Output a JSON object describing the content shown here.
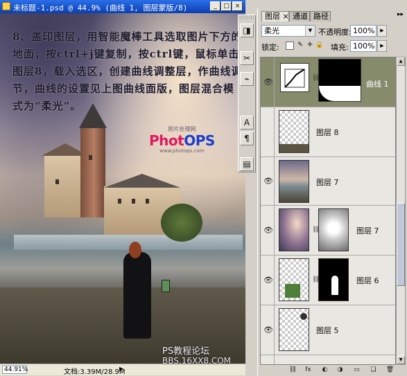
{
  "document": {
    "title": "未标题-1.psd @ 44.9% (曲线 1, 图层蒙版/8)",
    "instruction_text": "8、盖印图层，用智能魔棒工具选取图片下方的地面，按ctrl+j键复制，按ctrl键，鼠标单击图层8，载入选区，创建曲线调整层，作曲线调节，曲线的设置见上图曲线面版，图层混合模式为“柔光”。",
    "watermark_small_top": "照片处理网",
    "watermark_logo_a": "Phot",
    "watermark_logo_b": "OPS",
    "watermark_small_bottom": "www.photops.com",
    "forum_watermark": "PS教程论坛",
    "forum_watermark_line2": "BBS.16XX8.COM",
    "zoom": "44.91%",
    "doc_size": "文档:3.39M/28.9M",
    "title_buttons": [
      "_",
      "□",
      "×"
    ]
  },
  "tools": {
    "buttons": [
      "◨",
      "✂",
      "⌁",
      "A",
      "¶",
      "▤"
    ]
  },
  "layers_panel": {
    "tabs": [
      "图层 ×",
      "通道",
      "路径"
    ],
    "menu_icon": "▸▸",
    "blend_mode": "柔光",
    "opacity_label": "不透明度:",
    "opacity_value": "100%",
    "lock_label": "锁定:",
    "fill_label": "填充:",
    "fill_value": "100%",
    "layers": [
      {
        "name": "曲线 1",
        "selected": true
      },
      {
        "name": "图层 8",
        "selected": false
      },
      {
        "name": "图层 7",
        "selected": false
      },
      {
        "name": "图层 7",
        "selected": false
      },
      {
        "name": "图层 6",
        "selected": false
      },
      {
        "name": "图层 5",
        "selected": false
      }
    ],
    "bottom_icons": [
      "⛓",
      "fx",
      "◐",
      "◑",
      "▭",
      "❑",
      "🗑"
    ]
  },
  "colors": {
    "selected_layer": "#868b6c",
    "title_bar": "#0a3fb0",
    "logo_pink": "#e2195f",
    "logo_blue": "#1a3fcf"
  }
}
